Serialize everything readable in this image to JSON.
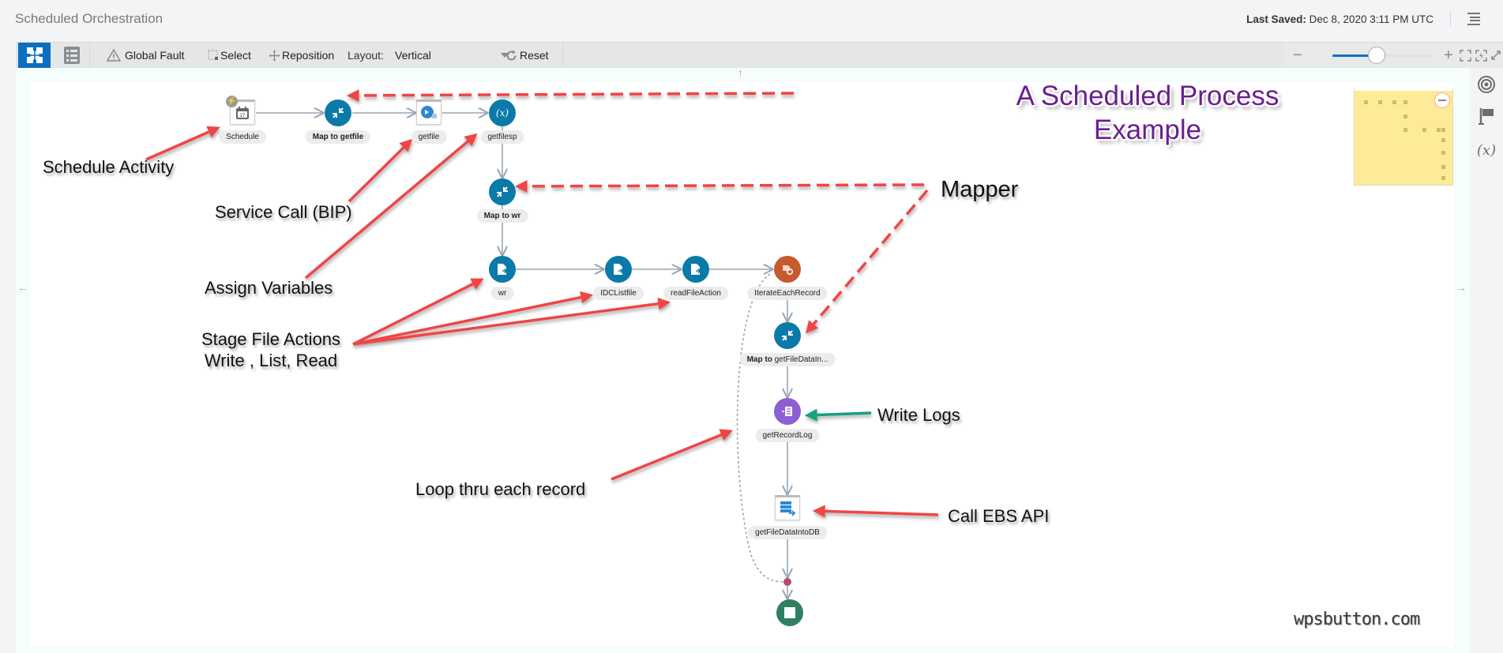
{
  "header": {
    "title": "Scheduled Orchestration",
    "last_saved_label": "Last Saved:",
    "last_saved_value": "Dec 8, 2020 3:11 PM UTC",
    "menu_icon": "hamburger-icon"
  },
  "toolbar": {
    "canvas_view_icon": "puzzle-icon",
    "list_view_icon": "list-icon",
    "global_fault_label": "Global Fault",
    "select_label": "Select",
    "reposition_label": "Reposition",
    "layout_label": "Layout:",
    "layout_value": "Vertical",
    "reset_label": "Reset",
    "zoom_out_icon": "minus-icon",
    "zoom_in_icon": "plus-icon",
    "zoom_level": 0.45,
    "fit_icon": "fit-icon",
    "auto_layout_icon": "auto-arrange-icon",
    "fullscreen_icon": "expand-icon"
  },
  "right_sidebar": {
    "icons": [
      "target-icon",
      "flag-icon",
      "variable-icon"
    ],
    "variable_glyph": "(x)"
  },
  "diagram": {
    "nodes": [
      {
        "id": "schedule",
        "label": "Schedule",
        "type": "schedule",
        "bold_prefix": ""
      },
      {
        "id": "map_getfile",
        "label": "getfile",
        "type": "mapper",
        "bold_prefix": "Map to "
      },
      {
        "id": "getfile",
        "label": "getfile",
        "type": "invoke-bip",
        "bold_prefix": ""
      },
      {
        "id": "getfilesp",
        "label": "getfilesp",
        "type": "assign",
        "bold_prefix": ""
      },
      {
        "id": "map_wr",
        "label": "wr",
        "type": "mapper",
        "bold_prefix": "Map to "
      },
      {
        "id": "wr",
        "label": "wr",
        "type": "stage-file",
        "bold_prefix": ""
      },
      {
        "id": "idclistfile",
        "label": "IDCListfile",
        "type": "stage-file",
        "bold_prefix": ""
      },
      {
        "id": "readfileaction",
        "label": "readFileAction",
        "type": "stage-file",
        "bold_prefix": ""
      },
      {
        "id": "iterate",
        "label": "IterateEachRecord",
        "type": "for-each",
        "bold_prefix": ""
      },
      {
        "id": "map_getfiledata",
        "label": "getFileDataIn...",
        "type": "mapper",
        "bold_prefix": "Map to "
      },
      {
        "id": "getrecordlog",
        "label": "getRecordLog",
        "type": "logger",
        "bold_prefix": ""
      },
      {
        "id": "getfiledataintodb",
        "label": "getFileDataIntoDB",
        "type": "invoke-ebs",
        "bold_prefix": ""
      },
      {
        "id": "merge",
        "label": "",
        "type": "merge",
        "bold_prefix": ""
      },
      {
        "id": "end",
        "label": "",
        "type": "stop",
        "bold_prefix": ""
      }
    ],
    "colors": {
      "mapper": "#0b7aa8",
      "assign": "#0b7aa8",
      "stage_file": "#0b7aa8",
      "for_each": "#c65a2e",
      "logger": "#8e5fd2",
      "stop": "#2f7f63",
      "merge": "#b84a6a",
      "edge": "#9aa6b2",
      "annotation_arrow": "#f04545",
      "logs_arrow": "#19a07e"
    }
  },
  "annotations": {
    "title_line1": "A Scheduled Process",
    "title_line2": "Example",
    "schedule_activity": "Schedule Activity",
    "service_call": "Service Call (BIP)",
    "assign_variables": "Assign Variables",
    "stage_file_line1": "Stage File Actions",
    "stage_file_line2": "Write , List, Read",
    "mapper": "Mapper",
    "write_logs": "Write Logs",
    "loop": "Loop thru each record",
    "call_ebs": "Call EBS API",
    "watermark": "wpsbutton.com"
  },
  "minimap": {
    "collapse_icon": "minus-circle-icon"
  }
}
